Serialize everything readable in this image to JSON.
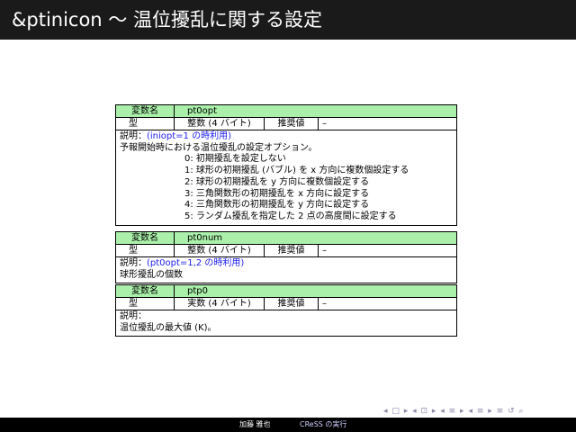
{
  "title": "&ptinicon ～ 温位擾乱に関する設定",
  "tables": [
    {
      "name_label": "変数名",
      "name": "pt0opt",
      "type_label": "型",
      "type_value": "整数 (4 バイト)",
      "rec_label": "推奨値",
      "rec_value": "–",
      "desc_label": "説明：",
      "desc_cond": "(iniopt=1 の時利用)",
      "desc_lines": [
        "予報開始時における温位擾乱の設定オプション。"
      ],
      "options": [
        "0: 初期擾乱を設定しない",
        "1: 球形の初期擾乱 (バブル) を x 方向に複数個設定する",
        "2: 球形の初期擾乱を y 方向に複数個設定する",
        "3: 三角関数形の初期擾乱を x 方向に設定する",
        "4: 三角関数形の初期擾乱を y 方向に設定する",
        "5: ランダム擾乱を指定した 2 点の高度間に設定する"
      ]
    },
    {
      "name_label": "変数名",
      "name": "pt0num",
      "type_label": "型",
      "type_value": "整数 (4 バイト)",
      "rec_label": "推奨値",
      "rec_value": "–",
      "desc_label": "説明：",
      "desc_cond": "(pt0opt=1,2 の時利用)",
      "desc_lines": [
        "球形擾乱の個数"
      ]
    },
    {
      "name_label": "変数名",
      "name": "ptp0",
      "type_label": "型",
      "type_value": "実数 (4 バイト)",
      "rec_label": "推奨値",
      "rec_value": "–",
      "desc_label": "説明：",
      "desc_cond": "",
      "desc_lines": [
        "温位擾乱の最大値 (K)。"
      ]
    }
  ],
  "nav_symbols": "◂ □ ▸ ◂ ⊡ ▸ ◂ ≡ ▸ ◂ ≡ ▸ ≡ ↺ ⌕",
  "footer": {
    "author": "加藤 雅也",
    "course": "CReSS の実行"
  }
}
